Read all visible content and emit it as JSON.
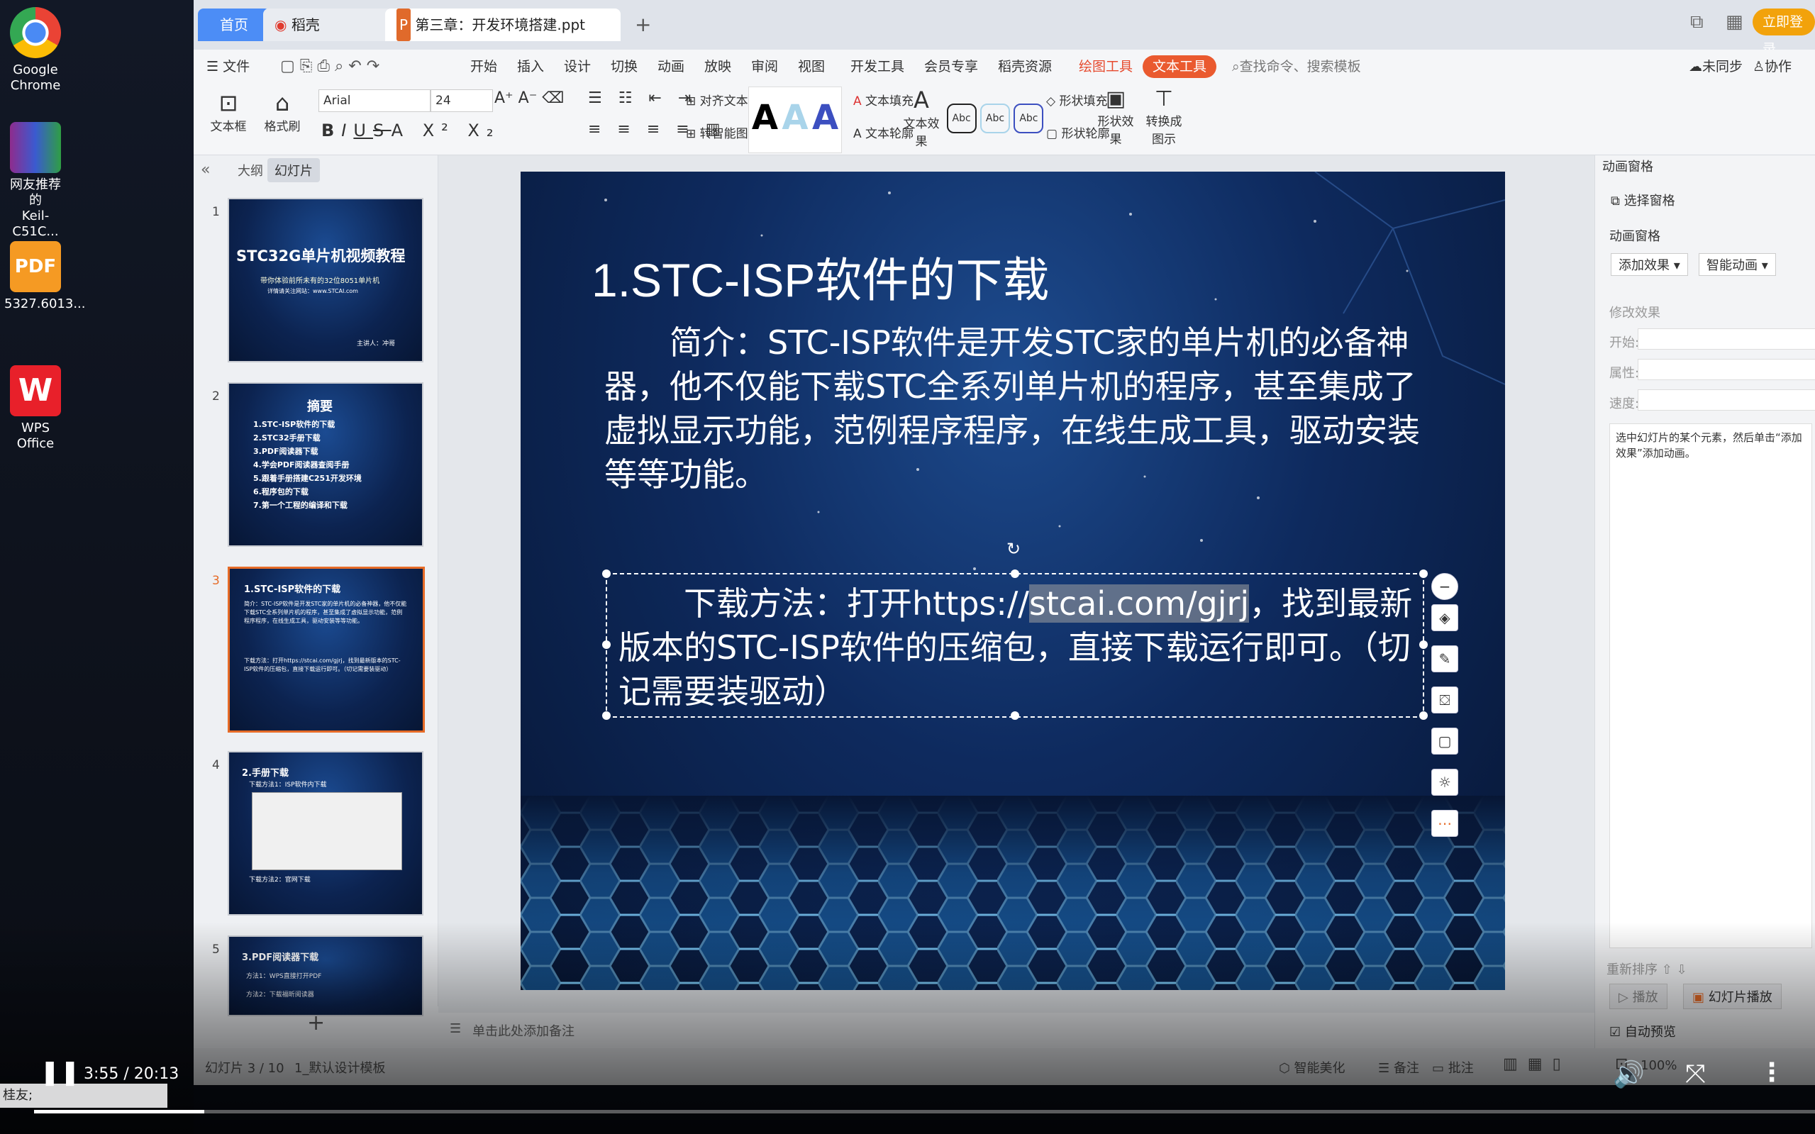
{
  "desktop": {
    "icons": [
      {
        "label1": "Google",
        "label2": "Chrome"
      },
      {
        "label1": "网友推荐的",
        "label2": "Keil-C51C..."
      },
      {
        "label1": "5327.6013...",
        "label2": ""
      },
      {
        "label1": "WPS Office",
        "label2": ""
      }
    ]
  },
  "tabs": {
    "home": "首页",
    "daoke": "稻壳",
    "doc": "第三章：开发环境搭建.ppt",
    "new_tab": "+"
  },
  "window_right": {
    "login": "立即登录",
    "unsynced": "未同步",
    "collab": "协作"
  },
  "menu": {
    "file": "文件",
    "items": [
      "开始",
      "插入",
      "设计",
      "切换",
      "动画",
      "放映",
      "审阅",
      "视图",
      "开发工具",
      "会员专享",
      "稻壳资源"
    ],
    "drawing_tools": "绘图工具",
    "text_tools": "文本工具",
    "search_placeholder": "查找命令、搜索模板"
  },
  "toolbar": {
    "textbox": "文本框",
    "format_painter": "格式刷",
    "font_name": "Arial",
    "font_size": "24",
    "align_text": "对齐文本",
    "smart_art": "转智能图形",
    "text_fill": "文本填充",
    "text_outline": "文本轮廓",
    "text_effect": "文本效果",
    "shape_fill": "形状填充",
    "shape_outline": "形状轮廓",
    "shape_effect": "形状效果",
    "convert_to_graphic": "转换成图示",
    "style_sample": "Abc",
    "big_a": "A"
  },
  "thumbpanel": {
    "outline_tab": "大纲",
    "slides_tab": "幻灯片",
    "add": "+",
    "thumbs": [
      {
        "num": "1",
        "title": "STC32G单片机视频教程",
        "sub": "带你体验前所未有的32位8051单片机",
        "site": "详情请关注网站：www.STCAI.com",
        "lecturer": "主讲人：冲哥"
      },
      {
        "num": "2",
        "title": "摘要",
        "lines": [
          "1.STC-ISP软件的下载",
          "2.STC32手册下载",
          "3.PDF阅读器下载",
          "4.学会PDF阅读器查阅手册",
          "5.跟着手册搭建C251开发环境",
          "6.程序包的下载",
          "7.第一个工程的编译和下载"
        ]
      },
      {
        "num": "3",
        "title": "1.STC-ISP软件的下载"
      },
      {
        "num": "4",
        "title": "2.手册下载",
        "line1": "下载方法1：ISP软件内下载",
        "line2": "下载方法2：官网下载"
      },
      {
        "num": "5",
        "title": "3.PDF阅读器下载",
        "line1": "方法1：WPS直接打开PDF",
        "line2": "方法2：下载福昕阅读器"
      }
    ]
  },
  "slide": {
    "title": "1.STC-ISP软件的下载",
    "para1": "简介：STC-ISP软件是开发STC家的单片机的必备神器，他不仅能下载STC全系列单片机的程序，甚至集成了虚拟显示功能，范例程序程序，在线生成工具，驱动安装等等功能。",
    "para2_pre": "下载方法：打开https://",
    "para2_url": "stcai.com/gjrj",
    "para2_post": "，找到最新版本的STC-ISP软件的压缩包，直接下载运行即可。（切记需要装驱动）"
  },
  "notes": {
    "placeholder": "单击此处添加备注"
  },
  "animpane": {
    "header": "动画窗格",
    "select_pane": "选择窗格",
    "section": "动画窗格",
    "add_effect": "添加效果",
    "smart_anim": "智能动画",
    "modify": "修改效果",
    "start": "开始:",
    "prop": "属性:",
    "speed": "速度:",
    "hint": "选中幻灯片的某个元素，然后单击“添加效果”添加动画。",
    "reorder": "重新排序",
    "play": "播放",
    "slideshow": "幻灯片播放",
    "autopreview": "自动预览"
  },
  "statusbar": {
    "slide_info": "幻灯片 3 / 10",
    "template": "1_默认设计模板",
    "beautify": "智能美化",
    "notes": "备注",
    "comment": "批注",
    "zoom": "100%"
  },
  "video": {
    "time": "3:55 / 20:13",
    "caption": "桂友;"
  }
}
